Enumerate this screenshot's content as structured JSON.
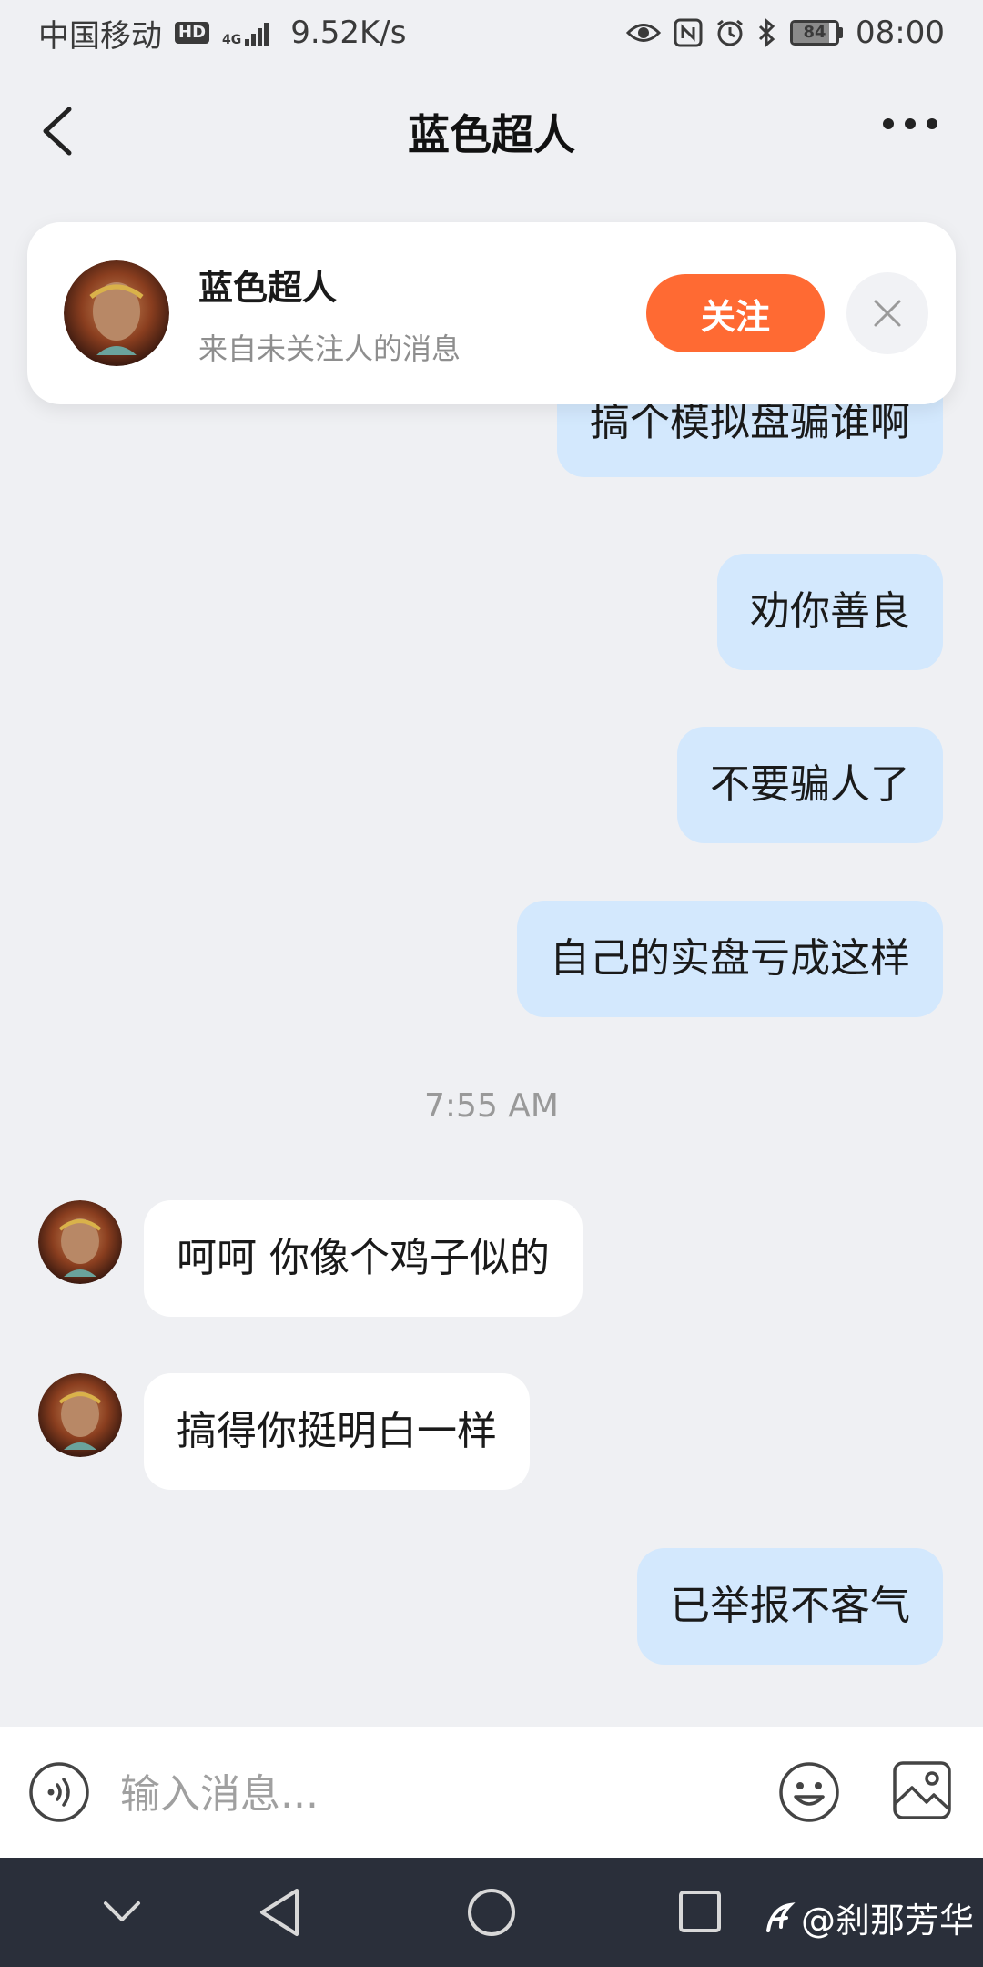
{
  "status_bar": {
    "carrier": "中国移动",
    "hd_badge": "HD",
    "network": "4G",
    "speed": "9.52K/s",
    "battery_level": "84",
    "time": "08:00"
  },
  "header": {
    "title": "蓝色超人",
    "back_icon": "chevron-left-icon",
    "more_icon": "more-dots-icon"
  },
  "follow_banner": {
    "name": "蓝色超人",
    "subtitle": "来自未关注人的消息",
    "follow_label": "关注",
    "accent_color": "#ff6a33"
  },
  "messages": [
    {
      "direction": "out",
      "text": "搞个模拟盘骗谁啊"
    },
    {
      "direction": "out",
      "text": "劝你善良"
    },
    {
      "direction": "out",
      "text": "不要骗人了"
    },
    {
      "direction": "out",
      "text": "自己的实盘亏成这样"
    },
    {
      "direction": "in",
      "text": "呵呵 你像个鸡子似的"
    },
    {
      "direction": "in",
      "text": "搞得你挺明白一样"
    },
    {
      "direction": "out",
      "text": "已举报不客气"
    }
  ],
  "timestamp": "7:55 AM",
  "input_bar": {
    "placeholder": "输入消息..."
  },
  "watermark": "@刹那芳华",
  "colors": {
    "outgoing_bubble": "#d3e8fd",
    "incoming_bubble": "#ffffff",
    "background": "#eff0f3"
  }
}
